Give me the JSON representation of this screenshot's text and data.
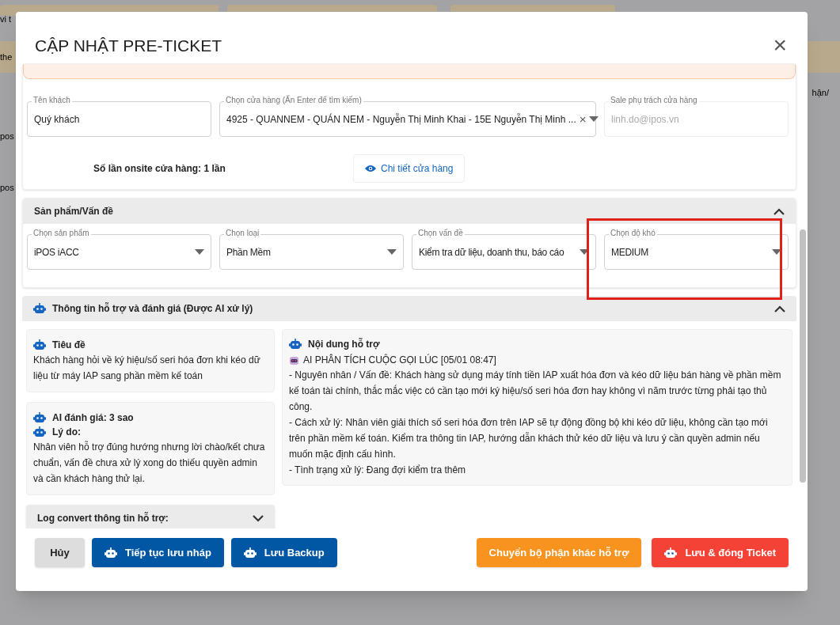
{
  "background": {
    "fragments": [
      {
        "text": "vi t"
      },
      {
        "text": "the"
      },
      {
        "text": "pos"
      },
      {
        "text": "pos"
      },
      {
        "text": "hận/"
      }
    ]
  },
  "dialog": {
    "title": "CẬP NHẬT PRE-TICKET",
    "close": "×"
  },
  "customer": {
    "fields": [
      {
        "label": "Tên khách",
        "value": "Quý khách",
        "kind": "text",
        "disabled": false
      },
      {
        "label": "Chọn cửa hàng (Ấn Enter để tìm kiếm)",
        "value": "4925 - QUANNEM - QUÁN NEM - Nguyễn Thị Minh Khai - 15E Nguyễn Thị Minh ...",
        "kind": "select",
        "clear": "×",
        "disabled": false
      },
      {
        "label": "Sale phụ trách cửa hàng",
        "value": "linh.do@ipos.vn",
        "kind": "text",
        "disabled": true
      }
    ],
    "onsite": "Số lần onsite cửa hàng: 1 lần",
    "detail_button": "Chi tiết cửa hàng"
  },
  "product": {
    "title": "Sản phẩm/Vấn đề",
    "expanded": true,
    "fields": [
      {
        "label": "Chọn sản phẩm",
        "value": "iPOS iACC",
        "highlighted": false
      },
      {
        "label": "Chọn loại",
        "value": "Phần Mềm",
        "highlighted": false
      },
      {
        "label": "Chọn vấn đề",
        "value": "Kiểm tra dữ liệu, doanh thu, báo cáo",
        "highlighted": false
      },
      {
        "label": "Chọn độ khó",
        "value": "MEDIUM",
        "highlighted": true
      }
    ]
  },
  "ai": {
    "title": "Thông tin hỗ trợ và đánh giá (Được AI xử lý)",
    "expanded": true,
    "subject": {
      "heading": "Tiêu đề",
      "text": "Khách hàng hỏi về ký hiệu/số seri hóa đơn khi kéo dữ liệu từ máy IAP sang phần mềm kế toán"
    },
    "rating": {
      "heading": "AI đánh giá: 3 sao",
      "reason_heading": "Lý do:",
      "text": "Nhân viên hỗ trợ đúng hướng nhưng lời chào/kết chưa chuẩn, vấn đề chưa xử lý xong do thiếu quyền admin và cần khách hàng thử lại."
    },
    "log": {
      "title": "Log convert thông tin hỗ trợ:",
      "expanded": false
    },
    "content": {
      "heading": "Nội dung hỗ trợ",
      "analysis": "AI PHÂN TÍCH CUỘC GỌI LÚC [05/01 08:47]",
      "lines": [
        "- Nguyên nhân / Vấn đề: Khách hàng sử dụng máy tính tiền IAP xuất hóa đơn và kéo dữ liệu bán hàng về phần mềm kế toán tài chính, thắc mắc việc có cần tạo mới ký hiệu/số seri hóa đơn hay không vì năm trước từng phải tạo thủ công.",
        "- Cách xử lý: Nhân viên giải thích số seri hóa đơn trên IAP sẽ tự động đồng bộ khi kéo dữ liệu, không cần tạo mới trên phần mềm kế toán. Kiểm tra thông tin IAP, hướng dẫn khách thử kéo dữ liệu và lưu ý cần quyền admin nếu muốn mặc định cấu hình.",
        "- Tình trạng xử lý: Đang đợi kiểm tra thêm"
      ]
    }
  },
  "footer": {
    "left": [
      {
        "label": "Hủy",
        "kind": "neutral",
        "icon": false
      },
      {
        "label": "Tiếp tục lưu nháp",
        "kind": "primary",
        "icon": true
      },
      {
        "label": "Lưu Backup",
        "kind": "primary",
        "icon": true
      }
    ],
    "right": [
      {
        "label": "Chuyển bộ phận khác hỗ trợ",
        "kind": "warning",
        "icon": false
      },
      {
        "label": "Lưu & đóng Ticket",
        "kind": "danger",
        "icon": true
      }
    ]
  }
}
